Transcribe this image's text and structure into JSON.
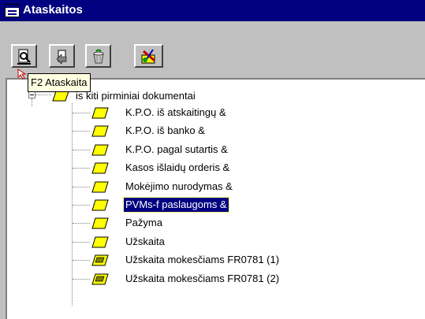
{
  "window": {
    "title": "Ataskaitos"
  },
  "toolbar": {
    "buttons": [
      {
        "name": "preview",
        "icon": "magnifier-document-icon"
      },
      {
        "name": "edit",
        "icon": "document-arrow-icon"
      },
      {
        "name": "delete",
        "icon": "trash-icon"
      },
      {
        "name": "tools",
        "icon": "paint-tools-icon"
      }
    ]
  },
  "tooltip": {
    "text": "F2 Ataskaita"
  },
  "tree": {
    "root": {
      "label": "is kiti pirminiai dokumentai",
      "expanded": true,
      "icon": "folder-icon"
    },
    "items": [
      {
        "label": "K.P.O. iš atskaitingų &",
        "icon": "report-icon",
        "selected": false
      },
      {
        "label": "K.P.O. iš banko &",
        "icon": "report-icon",
        "selected": false
      },
      {
        "label": "K.P.O. pagal sutartis &",
        "icon": "report-icon",
        "selected": false
      },
      {
        "label": "Kasos išlaidų orderis &",
        "icon": "report-icon",
        "selected": false
      },
      {
        "label": "Mokėjimo nurodymas &",
        "icon": "report-icon",
        "selected": false
      },
      {
        "label": "PVMs-f paslaugoms &",
        "icon": "report-icon",
        "selected": true
      },
      {
        "label": "Pažyma",
        "icon": "report-icon",
        "selected": false
      },
      {
        "label": "Užskaita",
        "icon": "report-icon",
        "selected": false
      },
      {
        "label": "Užskaita mokesčiams FR0781 (1)",
        "icon": "report-table-icon",
        "selected": false
      },
      {
        "label": "Užskaita mokesčiams FR0781 (2)",
        "icon": "report-table-icon",
        "selected": false
      }
    ]
  },
  "colors": {
    "titlebar": "#000080",
    "selection": "#000080",
    "tooltip_bg": "#ffffe1",
    "node_yellow": "#ffff00"
  }
}
